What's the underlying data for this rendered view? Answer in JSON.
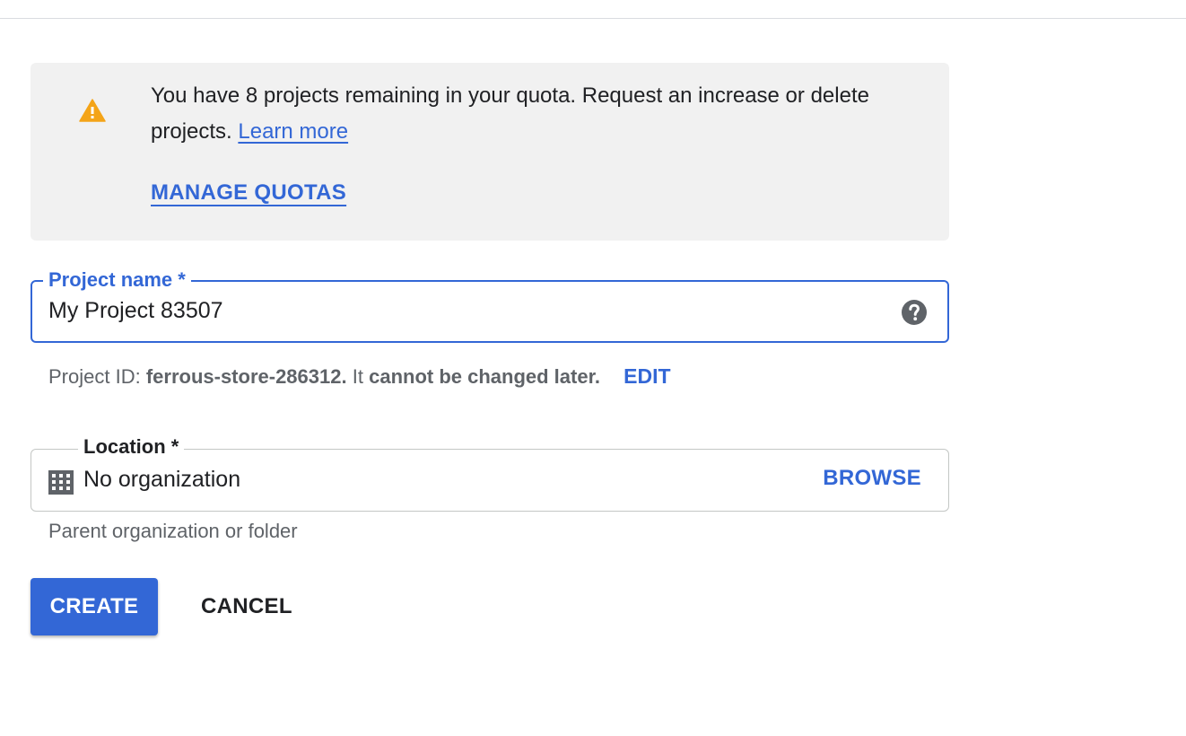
{
  "colors": {
    "accent": "#3367d6",
    "warning": "#f4a418",
    "banner_bg": "#f1f1f1",
    "help_icon": "#5f6368"
  },
  "quota_banner": {
    "icon": "warning-icon",
    "message": "You have 8 projects remaining in your quota. Request an increase or delete projects.",
    "learn_more_label": "Learn more",
    "manage_quotas_label": "MANAGE QUOTAS"
  },
  "project_name_field": {
    "label": "Project name *",
    "value": "My Project 83507",
    "help_icon": "help-icon"
  },
  "project_id": {
    "prefix": "Project ID:",
    "id": "ferrous-store-286312.",
    "middle": "It",
    "note": "cannot be changed later.",
    "edit_label": "EDIT"
  },
  "location_field": {
    "label": "Location *",
    "icon": "building-icon",
    "value": "No organization",
    "browse_label": "BROWSE",
    "helper_text": "Parent organization or folder"
  },
  "actions": {
    "create_label": "CREATE",
    "cancel_label": "CANCEL"
  }
}
